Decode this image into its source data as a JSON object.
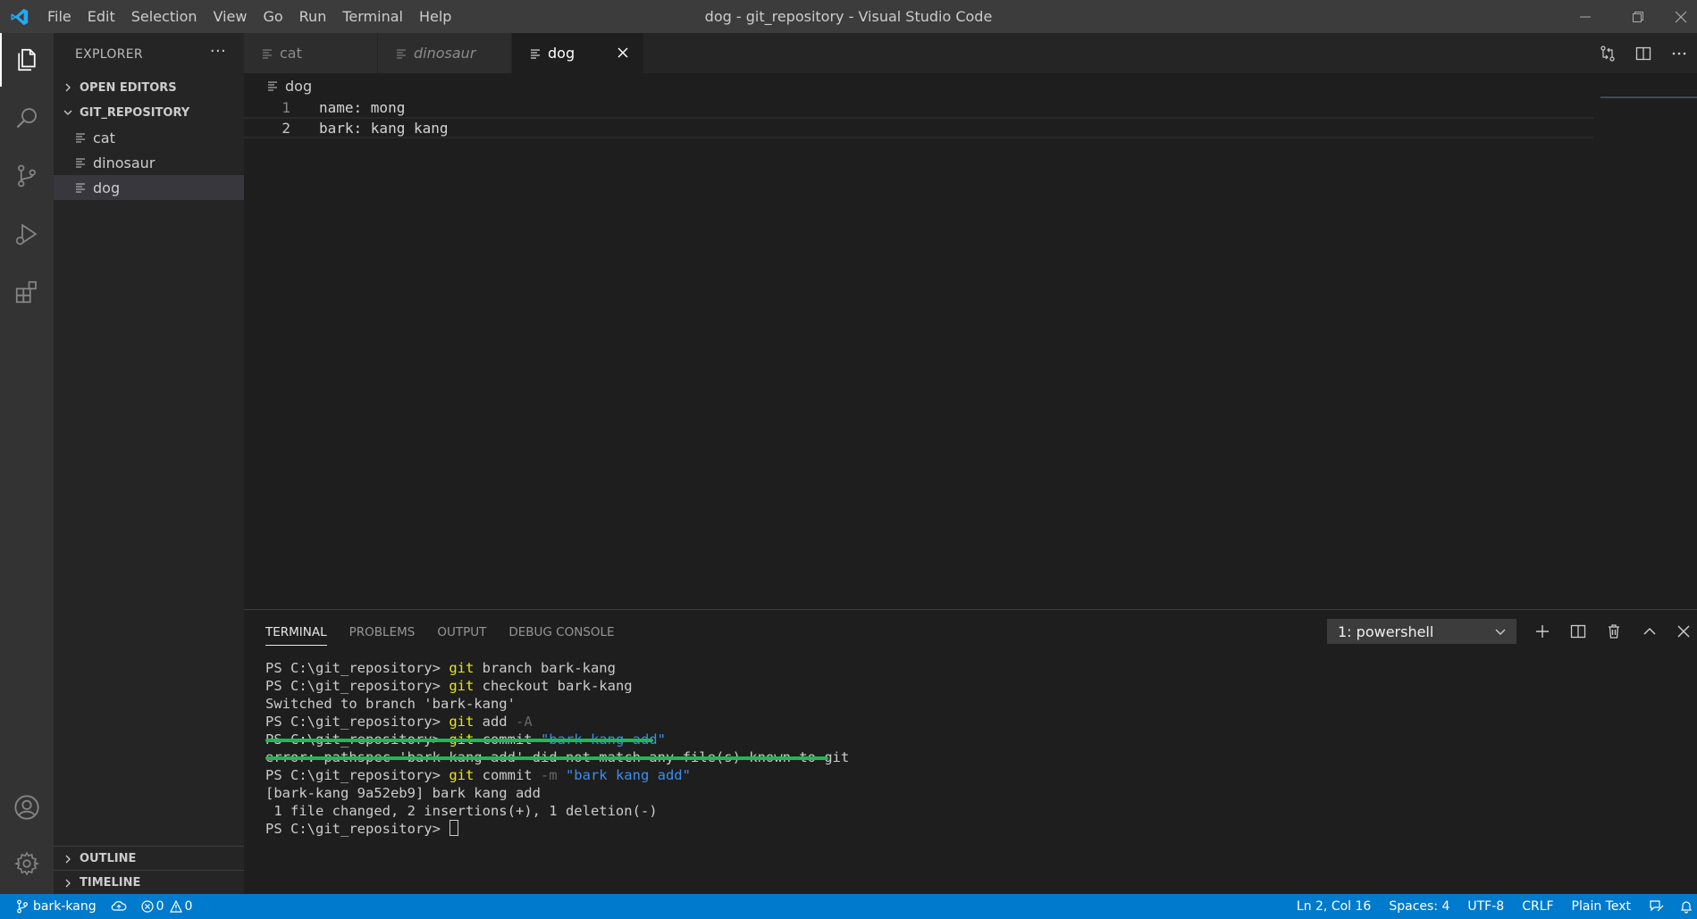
{
  "window": {
    "title": "dog - git_repository - Visual Studio Code"
  },
  "menu": [
    "File",
    "Edit",
    "Selection",
    "View",
    "Go",
    "Run",
    "Terminal",
    "Help"
  ],
  "sidebar": {
    "title": "EXPLORER",
    "more": "···",
    "open_editors": "OPEN EDITORS",
    "repo": "GIT_REPOSITORY",
    "files": [
      "cat",
      "dinosaur",
      "dog"
    ],
    "outline": "OUTLINE",
    "timeline": "TIMELINE"
  },
  "tabs": [
    {
      "label": "cat"
    },
    {
      "label": "dinosaur"
    },
    {
      "label": "dog"
    }
  ],
  "editor": {
    "breadcrumb": "dog",
    "lines": [
      {
        "num": "1",
        "text": "name: mong"
      },
      {
        "num": "2",
        "text": "bark: kang kang"
      }
    ]
  },
  "panel": {
    "tabs": [
      "TERMINAL",
      "PROBLEMS",
      "OUTPUT",
      "DEBUG CONSOLE"
    ],
    "terminal_select": "1: powershell",
    "lines": {
      "l1_prompt": "PS C:\\git_repository> ",
      "l1_git": "git",
      "l1_rest": " branch bark-kang",
      "l2_prompt": "PS C:\\git_repository> ",
      "l2_git": "git",
      "l2_rest": " checkout bark-kang",
      "l3": "Switched to branch 'bark-kang'",
      "l4_prompt": "PS C:\\git_repository> ",
      "l4_git": "git",
      "l4_rest": " add ",
      "l4_flag": "-A",
      "l5_prompt": "PS C:\\git_repository> ",
      "l5_git": "git",
      "l5_rest": " commit ",
      "l5_str": "\"bark kang add\"",
      "l6": "error: pathspec 'bark kang add' did not match any file(s) known to git",
      "l7_prompt": "PS C:\\git_repository> ",
      "l7_git": "git",
      "l7_rest": " commit ",
      "l7_flag": "-m",
      "l7_str": " \"bark kang add\"",
      "l8": "[bark-kang 9a52eb9] bark kang add",
      "l9": " 1 file changed, 2 insertions(+), 1 deletion(-)",
      "l10_prompt": "PS C:\\git_repository> "
    }
  },
  "status": {
    "branch": "bark-kang",
    "errors": "0",
    "warnings": "0",
    "position": "Ln 2, Col 16",
    "spaces": "Spaces: 4",
    "encoding": "UTF-8",
    "eol": "CRLF",
    "language": "Plain Text"
  },
  "colors": {
    "accent": "#007acc",
    "titlebar": "#3c3c3c",
    "activitybar": "#333333",
    "sidebar": "#252526",
    "editor": "#1e1e1e",
    "terminal_git": "#e5e510",
    "terminal_string": "#3b8eea",
    "strike_annotation": "#1db954"
  },
  "icons": [
    "vscode-logo-icon",
    "files-icon",
    "search-icon",
    "source-control-icon",
    "run-debug-icon",
    "extensions-icon",
    "account-icon",
    "settings-gear-icon",
    "minimize-icon",
    "restore-icon",
    "close-icon",
    "open-changes-icon",
    "split-editor-icon",
    "more-actions-icon",
    "plus-icon",
    "trash-icon",
    "chevron-up-icon",
    "branch-icon",
    "sync-icon",
    "error-icon",
    "warning-icon",
    "feedback-icon",
    "bell-icon"
  ]
}
